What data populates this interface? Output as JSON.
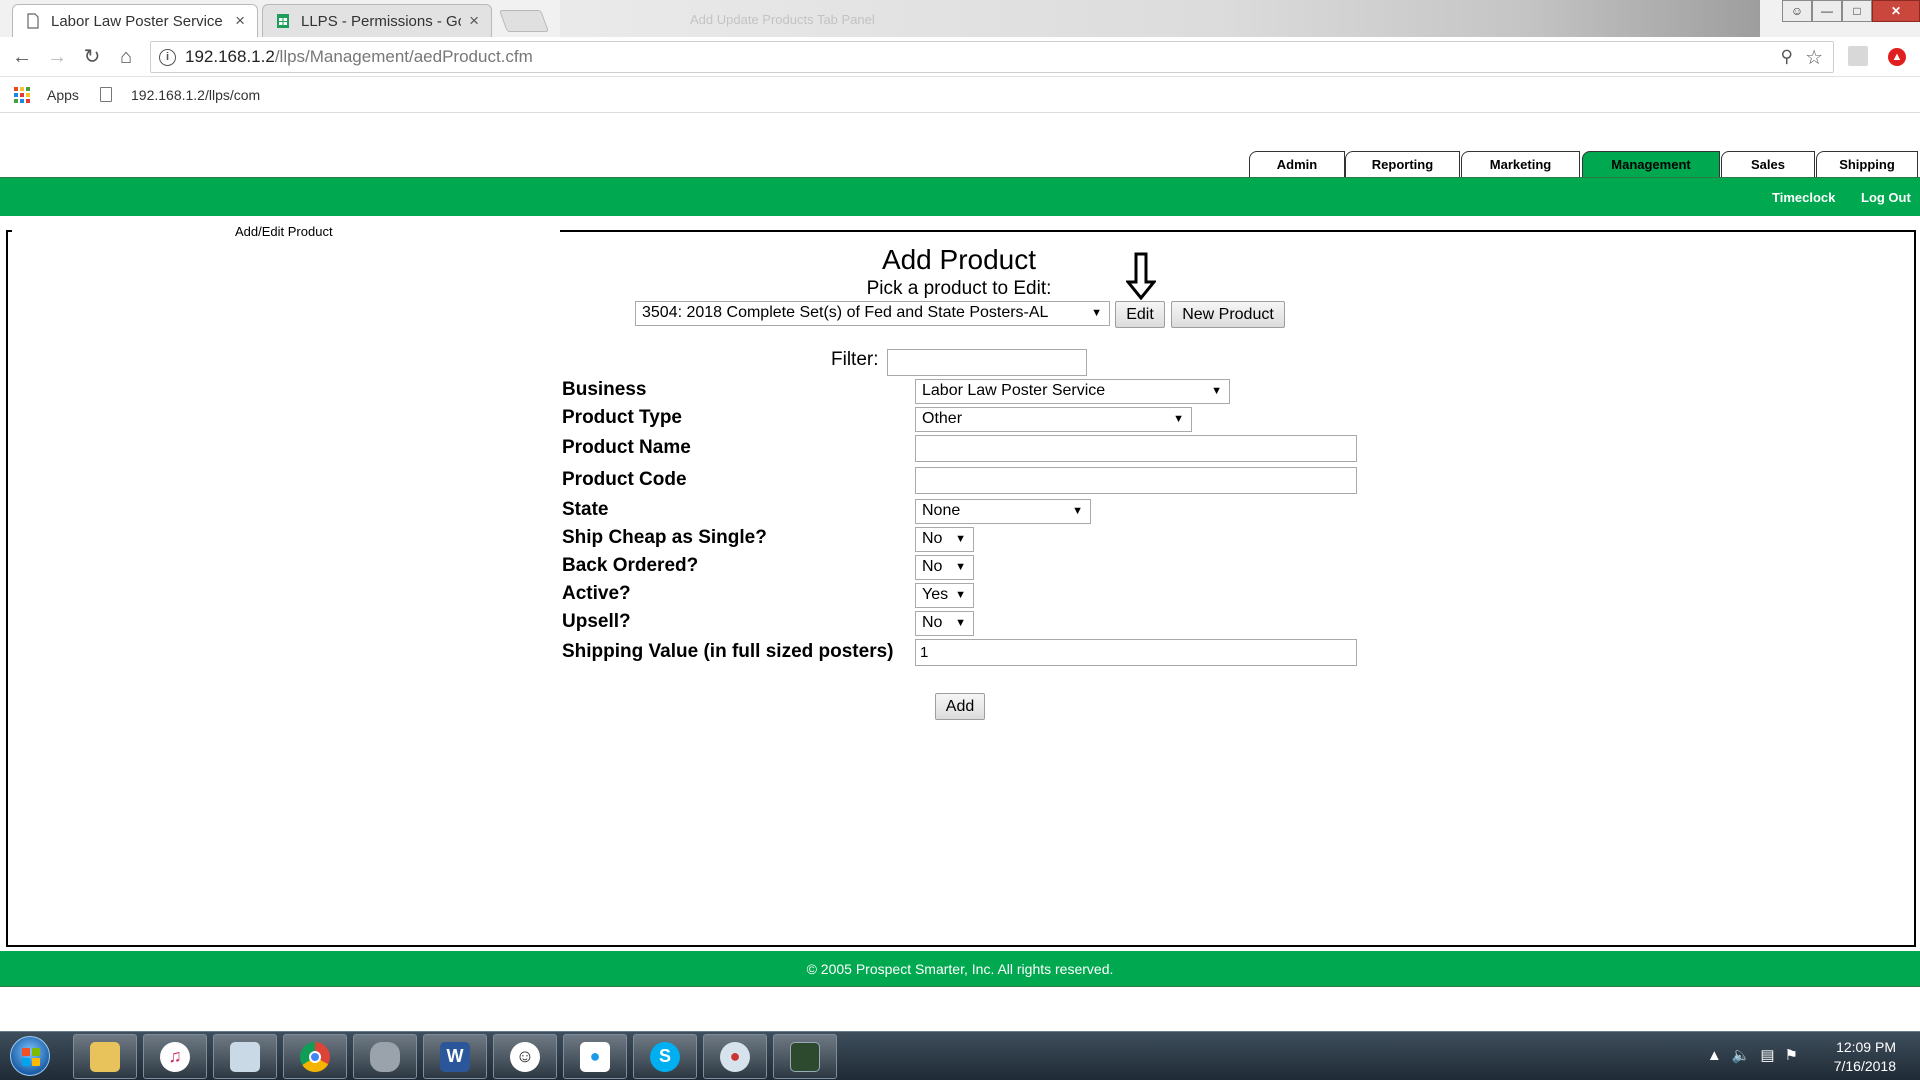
{
  "browser": {
    "tabs": [
      {
        "title": "Labor Law Poster Service",
        "active": true
      },
      {
        "title": "LLPS - Permissions - Goo",
        "active": false
      }
    ],
    "ghost_window_title": "Add Update Products Tab Panel",
    "url_host": "192.168.1.2",
    "url_path": "/llps/Management/aedProduct.cfm",
    "bookmarks": {
      "apps_label": "Apps",
      "link_label": "192.168.1.2/llps/com"
    }
  },
  "site": {
    "nav_tabs": [
      "Admin",
      "Reporting",
      "Marketing",
      "Management",
      "Sales",
      "Shipping"
    ],
    "active_tab": "Management",
    "subnav": {
      "timeclock": "Timeclock",
      "logout": "Log Out"
    },
    "breadcrumb": "Add/Edit Product",
    "brand_color": "#00a94f"
  },
  "form": {
    "title": "Add Product",
    "pick_label": "Pick a product to Edit:",
    "product_select": "3504: 2018 Complete Set(s) of Fed and State Posters-AL",
    "edit_button": "Edit",
    "new_product_button": "New Product",
    "filter_label": "Filter:",
    "filter_value": "",
    "fields": {
      "business": {
        "label": "Business",
        "value": "Labor Law Poster Service"
      },
      "product_type": {
        "label": "Product Type",
        "value": "Other"
      },
      "product_name": {
        "label": "Product Name",
        "value": ""
      },
      "product_code": {
        "label": "Product Code",
        "value": ""
      },
      "state": {
        "label": "State",
        "value": "None"
      },
      "ship_cheap": {
        "label": "Ship Cheap as Single?",
        "value": "No"
      },
      "back_ordered": {
        "label": "Back Ordered?",
        "value": "No"
      },
      "active": {
        "label": "Active?",
        "value": "Yes"
      },
      "upsell": {
        "label": "Upsell?",
        "value": "No"
      },
      "shipping_value": {
        "label": "Shipping Value (in full sized posters)",
        "value": "1"
      }
    },
    "add_button": "Add"
  },
  "footer": {
    "copyright": "© 2005 Prospect Smarter, Inc. All rights reserved."
  },
  "taskbar": {
    "apps": [
      "file-explorer",
      "itunes",
      "photo-viewer",
      "chrome",
      "database",
      "word",
      "smiley",
      "app-blue",
      "skype",
      "paint",
      "terminal"
    ],
    "clock_time": "12:09 PM",
    "clock_date": "7/16/2018"
  }
}
